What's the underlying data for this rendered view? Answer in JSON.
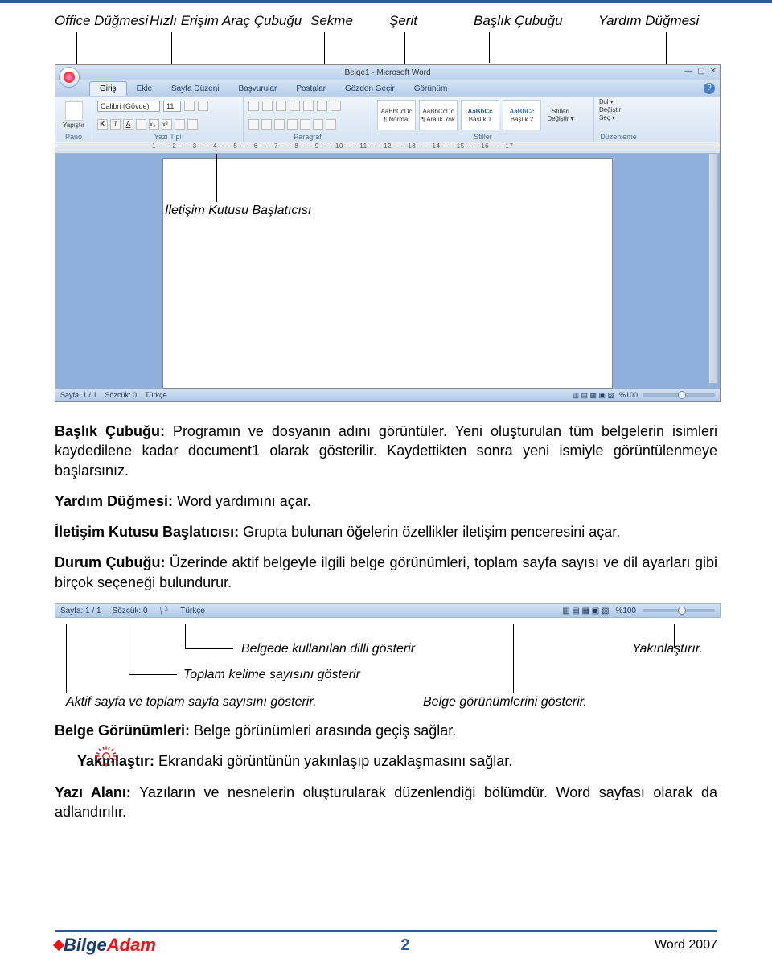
{
  "top_labels": {
    "office": "Office Düğmesi",
    "qat": "Hızlı Erişim Araç Çubuğu",
    "tab": "Sekme",
    "ribbon": "Şerit",
    "titlebar": "Başlık Çubuğu",
    "help": "Yardım Düğmesi"
  },
  "word_ui": {
    "title": "Belge1 - Microsoft Word",
    "tabs": [
      "Giriş",
      "Ekle",
      "Sayfa Düzeni",
      "Başvurular",
      "Postalar",
      "Gözden Geçir",
      "Görünüm"
    ],
    "font_name": "Calibri (Gövde)",
    "font_size": "11",
    "groups": {
      "pano": "Pano",
      "yazi": "Yazı Tipi",
      "paragraf": "Paragraf",
      "stiller": "Stiller",
      "duzenleme": "Düzenleme"
    },
    "styles": [
      {
        "preview": "AaBbCcDc",
        "name": "¶ Normal"
      },
      {
        "preview": "AaBbCcDc",
        "name": "¶ Aralık Yok"
      },
      {
        "preview": "AaBbCc",
        "name": "Başlık 1"
      },
      {
        "preview": "AaBbCc",
        "name": "Başlık 2"
      }
    ],
    "stilleri": "Stilleri Değiştir ▾",
    "edit": {
      "bul": "Bul ▾",
      "degistir": "Değiştir",
      "sec": "Seç ▾"
    },
    "ruler": "1 · · · 2 · · · 3 · · · 4 · · · 5 · · · 6 · · · 7 · · · 8 · · · 9 · · · 10 · · · 11 · · · 12 · · · 13 · · · 14 · · · 15 · · · 16 · · · 17",
    "status": {
      "page": "Sayfa: 1 / 1",
      "words": "Sözcük: 0",
      "lang": "Türkçe",
      "zoom": "%100"
    }
  },
  "callout_launcher": "İletişim Kutusu Başlatıcısı",
  "paragraphs": {
    "p1_b": "Başlık Çubuğu:",
    "p1": " Programın ve dosyanın adını görüntüler. Yeni oluşturulan tüm belgelerin isimleri kaydedilene kadar document1 olarak gösterilir. Kaydettikten sonra yeni ismiyle görüntülenmeye başlarsınız.",
    "p2_b": "Yardım Düğmesi:",
    "p2": " Word yardımını açar.",
    "p3_b": "İletişim Kutusu Başlatıcısı:",
    "p3": " Grupta bulunan öğelerin özellikler iletişim penceresini açar.",
    "p4_b": "Durum Çubuğu:",
    "p4": " Üzerinde aktif belgeyle ilgili belge görünümleri, toplam sayfa sayısı ve dil ayarları gibi birçok seçeneği bulundurur."
  },
  "status2": {
    "page": "Sayfa: 1 / 1",
    "words": "Sözcük: 0",
    "lang": "Türkçe",
    "zoom": "%100"
  },
  "status_callouts": {
    "lang": "Belgede kullanılan dilli gösterir",
    "words": "Toplam kelime sayısını gösterir",
    "page": "Aktif sayfa ve toplam sayfa sayısını gösterir.",
    "views": "Belge görünümlerini gösterir.",
    "zoom": "Yakınlaştırır."
  },
  "paragraphs2": {
    "p5_b": "Belge Görünümleri:",
    "p5": " Belge görünümleri arasında geçiş sağlar.",
    "p6_b": "Yakınlaştır:",
    "p6": " Ekrandaki görüntünün yakınlaşıp uzaklaşmasını sağlar.",
    "p7_b": "Yazı Alanı:",
    "p7": " Yazıların ve nesnelerin oluşturularak düzenlendiği bölümdür. Word sayfası olarak da adlandırılır."
  },
  "footer": {
    "page": "2",
    "right": "Word 2007",
    "logo1": "Bilge",
    "logo2": "Adam"
  }
}
